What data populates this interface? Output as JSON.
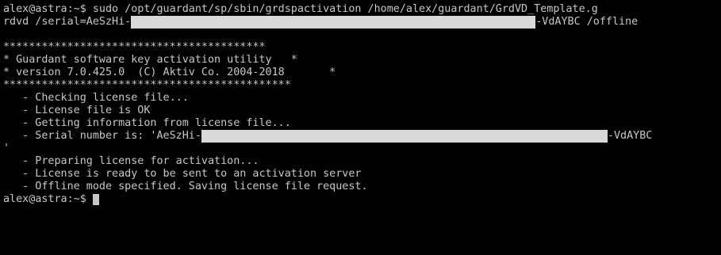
{
  "terminal": {
    "prompt_cmd_1": "alex@astra:~$ sudo /opt/guardant/sp/sbin/grdspactivation /home/alex/guardant/GrdVD_Template.g",
    "cmd_cont_pre": "rdvd /serial=AeSzHi-",
    "cmd_cont_post": "-VdAYBC /offline",
    "blank": "",
    "stars_top": "*****************************************",
    "banner_1": "* Guardant software key activation utility   *",
    "banner_2": "* version 7.0.425.0  (C) Aktiv Co. 2004-2018       *",
    "stars_bottom": "*********************************************",
    "msg_checking": "   - Checking license file...",
    "msg_ok": "   - License file is OK",
    "msg_getting": "   - Getting information from license file...",
    "msg_serial_pre": "   - Serial number is: 'AeSzHi-",
    "msg_serial_post": "-VdAYBC",
    "quote_close": "'",
    "msg_preparing": "   - Preparing license for activation...",
    "msg_ready": "   - License is ready to be sent to an activation server",
    "msg_offline": "   - Offline mode specified. Saving license file request.",
    "prompt_final": "alex@astra:~$ "
  },
  "colors": {
    "background": "#000000",
    "text": "#c7c7c7",
    "redaction": "#d9d9d9"
  }
}
